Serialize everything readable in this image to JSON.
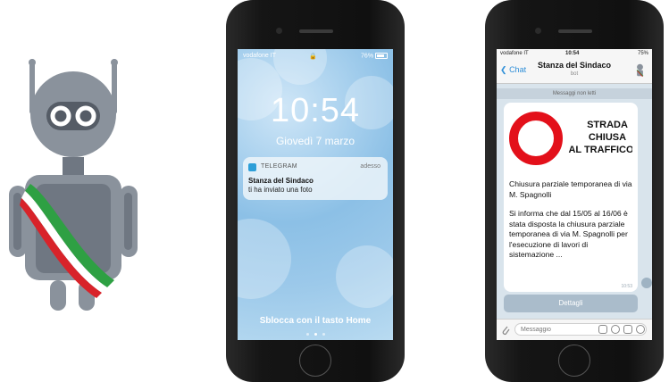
{
  "lock_screen": {
    "carrier": "vodafone IT",
    "battery": "76%",
    "time": "10:54",
    "date": "Giovedì 7 marzo",
    "notification": {
      "app": "TELEGRAM",
      "when": "adesso",
      "title": "Stanza del Sindaco",
      "body": "ti ha inviato una foto"
    },
    "unlock_hint": "Sblocca con il tasto Home"
  },
  "chat_screen": {
    "carrier": "vodafone IT",
    "time": "10:54",
    "battery": "75%",
    "back_label": "Chat",
    "title": "Stanza del Sindaco",
    "subtitle": "bot",
    "unread_label": "Messaggi non letti",
    "sign": {
      "line1": "STRADA",
      "line2": "CHIUSA",
      "line3": "AL TRAFFICO"
    },
    "message_title": "Chiusura parziale temporanea di via M. Spagnolli",
    "message_body": "Si informa che dal 15/05 al 16/06 è stata disposta la chiusura parziale temporanea di via M. Spagnolli per l'esecuzione di lavori di sistemazione ...",
    "message_time": "10:53",
    "details_button": "Dettagli",
    "input_placeholder": "Messaggio"
  },
  "colors": {
    "telegram_blue": "#2f8fd8",
    "sign_red": "#e3101a",
    "robot_gray": "#8a929c",
    "sash_green": "#2ea043",
    "sash_red": "#d8232a"
  }
}
